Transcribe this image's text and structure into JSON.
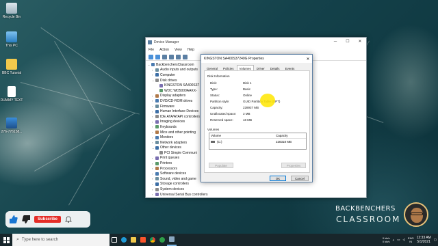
{
  "desktop": {
    "icons": [
      {
        "label": "Recycle Bin"
      },
      {
        "label": "This PC"
      },
      {
        "label": "BBC Tutorial"
      },
      {
        "label": "DUMMY TEXT"
      },
      {
        "label": "276-776158..."
      }
    ]
  },
  "device_manager": {
    "title": "Device Manager",
    "menu": [
      "File",
      "Action",
      "View",
      "Help"
    ],
    "tree": [
      {
        "label": "BackbenchersClassroom",
        "level": 0,
        "expanded": true
      },
      {
        "label": "Audio inputs and outputs",
        "level": 1
      },
      {
        "label": "Computer",
        "level": 1
      },
      {
        "label": "Disk drives",
        "level": 1,
        "expanded": true
      },
      {
        "label": "KINGSTON SA400S37",
        "level": 2
      },
      {
        "label": "WDC WD5000AAKX-",
        "level": 2
      },
      {
        "label": "Display adapters",
        "level": 1
      },
      {
        "label": "DVD/CD-ROM drives",
        "level": 1
      },
      {
        "label": "Firmware",
        "level": 1
      },
      {
        "label": "Human Interface Devices",
        "level": 1
      },
      {
        "label": "IDE ATA/ATAPI controllers",
        "level": 1
      },
      {
        "label": "Imaging devices",
        "level": 1
      },
      {
        "label": "Keyboards",
        "level": 1
      },
      {
        "label": "Mice and other pointing",
        "level": 1
      },
      {
        "label": "Monitors",
        "level": 1
      },
      {
        "label": "Network adapters",
        "level": 1
      },
      {
        "label": "Other devices",
        "level": 1,
        "expanded": true
      },
      {
        "label": "PCI Simple Communi",
        "level": 2
      },
      {
        "label": "Print queues",
        "level": 1
      },
      {
        "label": "Printers",
        "level": 1
      },
      {
        "label": "Processors",
        "level": 1
      },
      {
        "label": "Software devices",
        "level": 1
      },
      {
        "label": "Sound, video and game",
        "level": 1
      },
      {
        "label": "Storage controllers",
        "level": 1
      },
      {
        "label": "System devices",
        "level": 1
      },
      {
        "label": "Universal Serial Bus controllers",
        "level": 1
      }
    ]
  },
  "properties": {
    "title": "KINGSTON SA400S37240G Properties",
    "tabs": [
      "General",
      "Policies",
      "Volumes",
      "Driver",
      "Details",
      "Events"
    ],
    "active_tab": "Volumes",
    "disk_info_label": "Disk Information",
    "fields": [
      {
        "key": "Disk:",
        "value": "Disk 1"
      },
      {
        "key": "Type:",
        "value": "Basic"
      },
      {
        "key": "Status:",
        "value": "Online"
      },
      {
        "key": "Partition style:",
        "value": "GUID Partition Table (GPT)"
      },
      {
        "key": "Capacity:",
        "value": "228937 MB"
      },
      {
        "key": "Unallocated space:",
        "value": "3 MB"
      },
      {
        "key": "Reserved space:",
        "value": "18 MB"
      }
    ],
    "volumes_label": "Volumes",
    "volume_columns": [
      "Volume",
      "Capacity"
    ],
    "volumes": [
      {
        "name": "(C:)",
        "capacity": "228318 MB"
      }
    ],
    "populate_label": "Populate",
    "properties_label": "Properties",
    "ok_label": "OK",
    "cancel_label": "Cancel"
  },
  "branding": {
    "line1": "BACKBENCHERS",
    "line2": "CLASSROOM"
  },
  "youtube": {
    "subscribe_label": "Subscribe"
  },
  "taskbar": {
    "search_placeholder": "Type here to search",
    "lang": "ENG",
    "region": "IN",
    "time": "12:33 AM",
    "date": "5/1/2021",
    "kb_speed1": "0 kb/s",
    "kb_speed2": "0 kb/s"
  },
  "colors": {
    "accent": "#0078d7",
    "subscribe": "#e52d27",
    "highlight": "#ffe600"
  }
}
